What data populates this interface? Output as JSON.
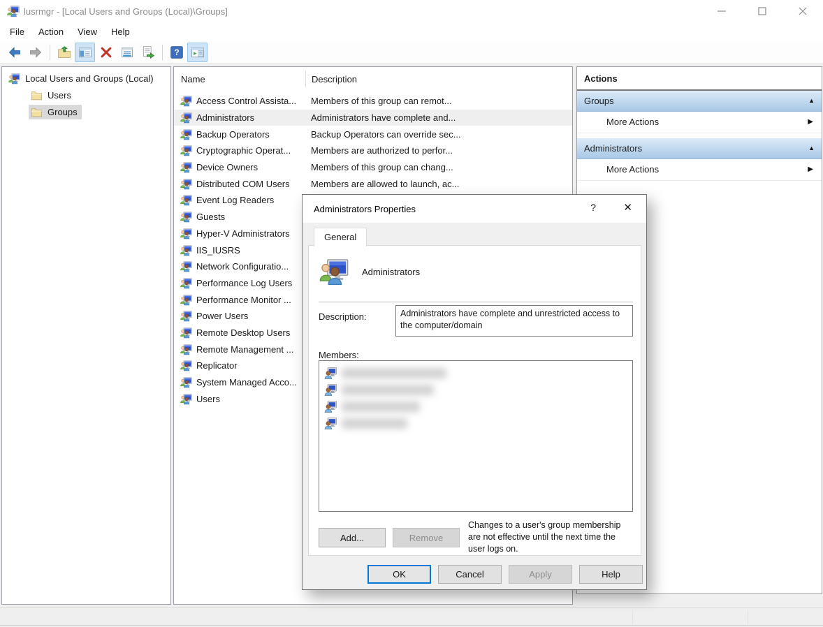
{
  "window": {
    "title": "lusrmgr - [Local Users and Groups (Local)\\Groups]",
    "controls": [
      "minimize",
      "maximize",
      "close"
    ]
  },
  "menubar": {
    "items": [
      "File",
      "Action",
      "View",
      "Help"
    ]
  },
  "toolbar": {
    "help_glyph": "?",
    "icons": [
      "back-icon",
      "forward-icon",
      "up-one-level-icon",
      "show-console-tree-icon",
      "delete-icon",
      "properties-icon",
      "export-list-icon",
      "help-icon",
      "show-action-pane-icon"
    ],
    "disabled": [
      "forward-icon"
    ],
    "toggled": [
      "show-console-tree-icon",
      "show-action-pane-icon"
    ]
  },
  "tree": {
    "root_label": "Local Users and Groups (Local)",
    "items": [
      {
        "label": "Users",
        "selected": false
      },
      {
        "label": "Groups",
        "selected": true
      }
    ]
  },
  "list": {
    "columns": [
      "Name",
      "Description"
    ],
    "rows": [
      {
        "name": "Access Control Assista...",
        "description": "Members of this group can remot...",
        "selected": false
      },
      {
        "name": "Administrators",
        "description": "Administrators have complete and...",
        "selected": true
      },
      {
        "name": "Backup Operators",
        "description": "Backup Operators can override sec...",
        "selected": false
      },
      {
        "name": "Cryptographic Operat...",
        "description": "Members are authorized to perfor...",
        "selected": false
      },
      {
        "name": "Device Owners",
        "description": "Members of this group can chang...",
        "selected": false
      },
      {
        "name": "Distributed COM Users",
        "description": "Members are allowed to launch, ac...",
        "selected": false
      },
      {
        "name": "Event Log Readers",
        "description": "",
        "selected": false
      },
      {
        "name": "Guests",
        "description": "",
        "selected": false
      },
      {
        "name": "Hyper-V Administrators",
        "description": "",
        "selected": false
      },
      {
        "name": "IIS_IUSRS",
        "description": "",
        "selected": false
      },
      {
        "name": "Network Configuratio...",
        "description": "",
        "selected": false
      },
      {
        "name": "Performance Log Users",
        "description": "",
        "selected": false
      },
      {
        "name": "Performance Monitor ...",
        "description": "",
        "selected": false
      },
      {
        "name": "Power Users",
        "description": "",
        "selected": false
      },
      {
        "name": "Remote Desktop Users",
        "description": "",
        "selected": false
      },
      {
        "name": "Remote Management ...",
        "description": "",
        "selected": false
      },
      {
        "name": "Replicator",
        "description": "",
        "selected": false
      },
      {
        "name": "System Managed Acco...",
        "description": "",
        "selected": false
      },
      {
        "name": "Users",
        "description": "",
        "selected": false
      }
    ]
  },
  "actions": {
    "title": "Actions",
    "collapse_glyph": "▲",
    "more_glyph": "▶",
    "sections": [
      {
        "header": "Groups",
        "items": [
          "More Actions"
        ]
      },
      {
        "header": "Administrators",
        "items": [
          "More Actions"
        ]
      }
    ]
  },
  "dialog": {
    "title": "Administrators Properties",
    "help_icon": "?",
    "close_icon": "✕",
    "tab_label": "General",
    "group_name": "Administrators",
    "description_label": "Description:",
    "description_value": "Administrators have complete and unrestricted access to the computer/domain",
    "members_label": "Members:",
    "members_count": 4,
    "add_label": "Add...",
    "remove_label": "Remove",
    "remove_disabled": true,
    "note": "Changes to a user's group membership are not effective until the next time the user logs on.",
    "ok_label": "OK",
    "cancel_label": "Cancel",
    "apply_label": "Apply",
    "apply_disabled": true,
    "help_label": "Help"
  },
  "colors": {
    "actions_header_gradient_top": "#dcebf8",
    "actions_header_gradient_bottom": "#a8c8e6",
    "ok_button_border": "#0078d7",
    "toolbar_toggle_bg": "#cfe4f7",
    "tree_selection_bg": "#d9d9d9",
    "list_selection_bg": "#efefef"
  }
}
